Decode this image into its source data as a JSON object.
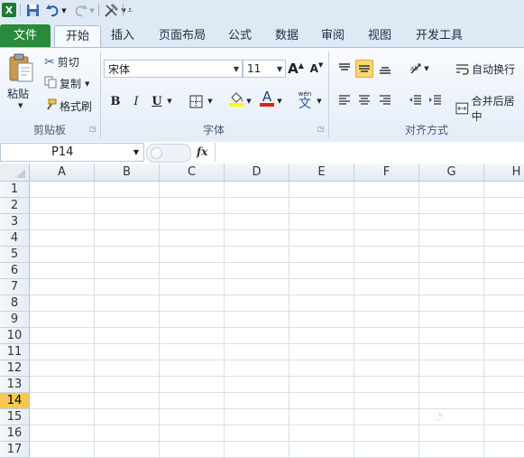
{
  "qat": {
    "logo_text": "X"
  },
  "tabs": [
    "文件",
    "开始",
    "插入",
    "页面布局",
    "公式",
    "数据",
    "审阅",
    "视图",
    "开发工具"
  ],
  "clipboard": {
    "paste_label": "粘贴",
    "cut_label": "剪切",
    "copy_label": "复制",
    "format_painter_label": "格式刷",
    "group_label": "剪贴板"
  },
  "font": {
    "font_name": "宋体",
    "font_size": "11",
    "bold": "B",
    "italic": "I",
    "underline": "U",
    "grow": "A",
    "shrink": "A",
    "font_color_letter": "A",
    "wen_top": "wén",
    "wen_char": "文",
    "group_label": "字体"
  },
  "alignment": {
    "wrap_text_label": "自动换行",
    "merge_center_label": "合并后居中",
    "group_label": "对齐方式"
  },
  "formula_bar": {
    "name_box": "P14",
    "fx": "fx"
  },
  "columns": [
    "A",
    "B",
    "C",
    "D",
    "E",
    "F",
    "G",
    "H"
  ],
  "rows": [
    "1",
    "2",
    "3",
    "4",
    "5",
    "6",
    "7",
    "8",
    "9",
    "10",
    "11",
    "12",
    "13",
    "14",
    "15",
    "16",
    "17"
  ],
  "selected_row": "14",
  "colors": {
    "accent_file_tab": "#2a8a3b",
    "selected_row": "#f8c753",
    "font_color_bar": "#e02020",
    "fill_color_bar": "#ffff00"
  }
}
